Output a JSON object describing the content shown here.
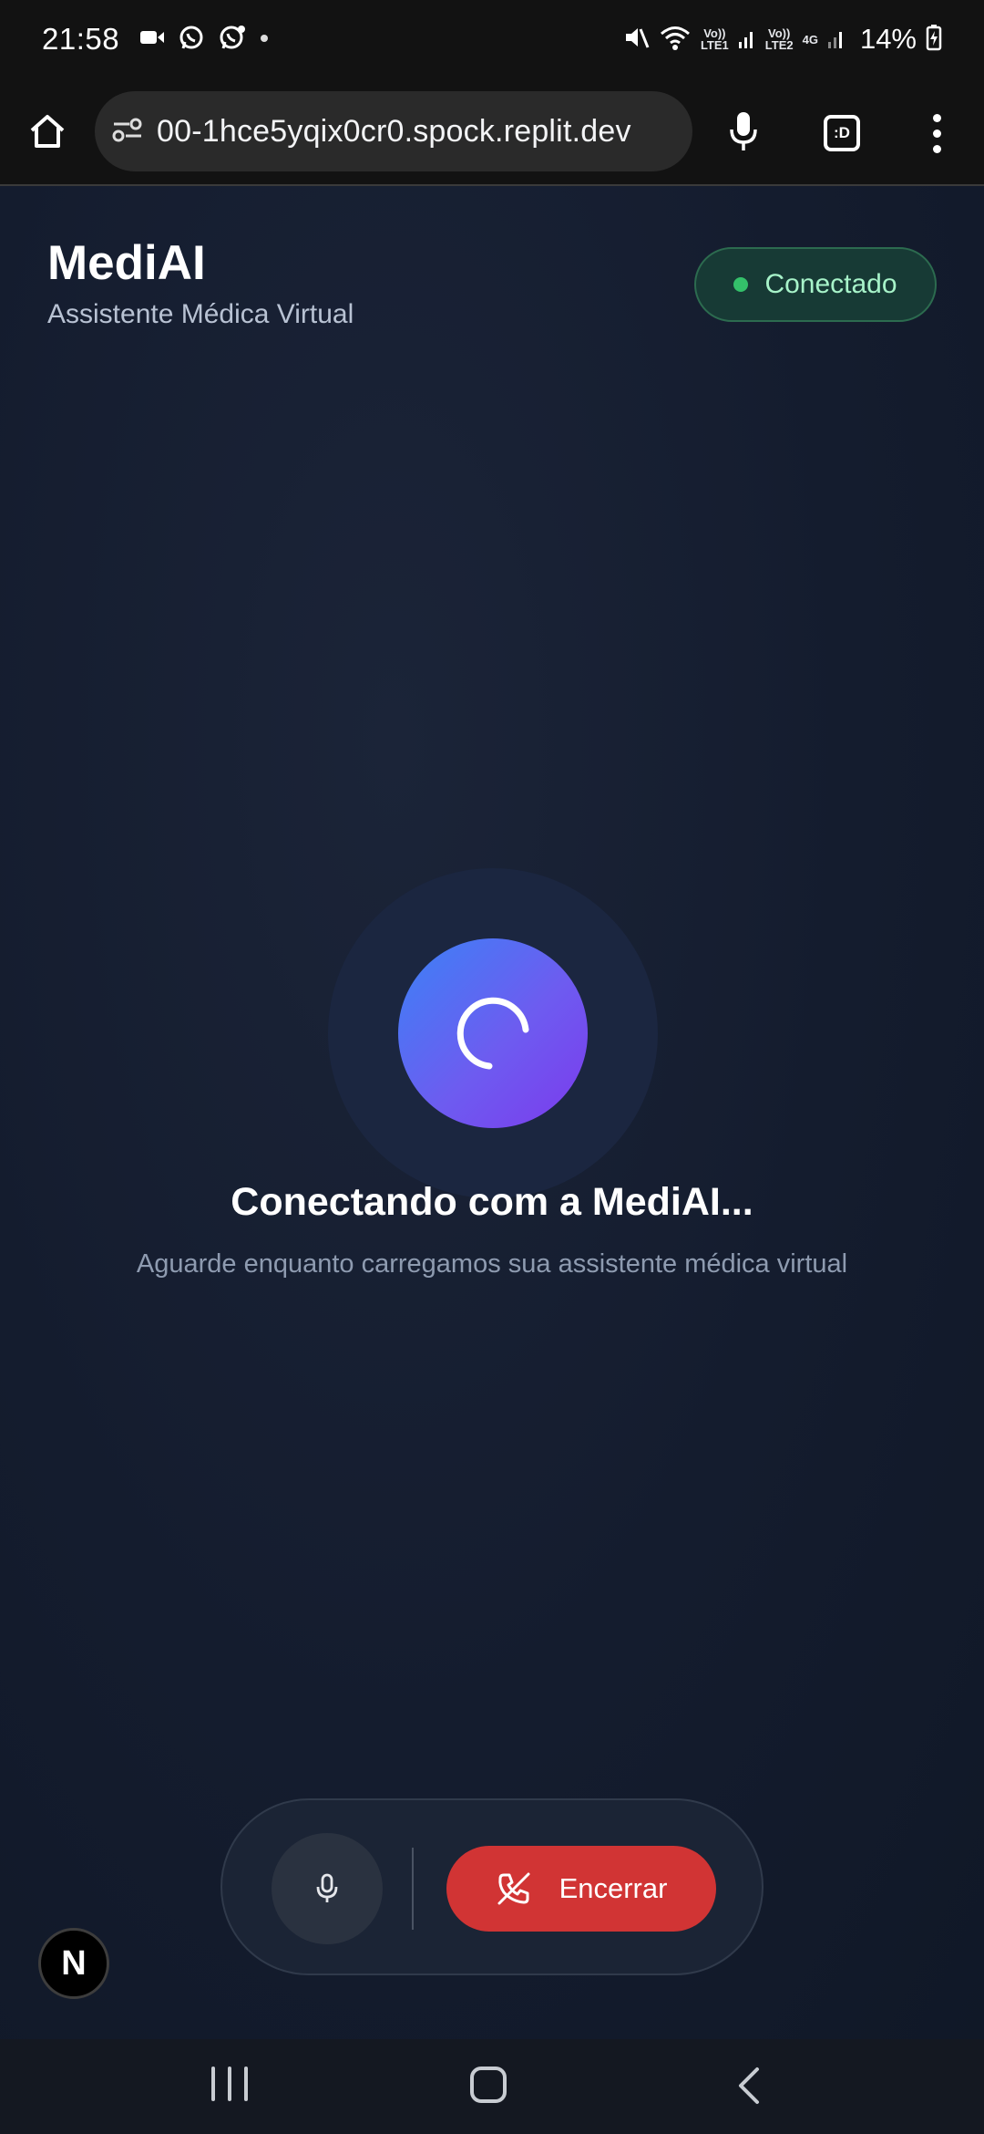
{
  "status_bar": {
    "time": "21:58",
    "battery": "14%",
    "sim1_label": "Vo))\nLTE1",
    "sim2_label": "Vo))\nLTE2",
    "network": "4G"
  },
  "browser": {
    "url": "00-1hce5yqix0cr0.spock.replit.dev",
    "tabs_label": ":D"
  },
  "app": {
    "title": "MediAI",
    "subtitle": "Assistente Médica Virtual",
    "status": "Conectado"
  },
  "loading": {
    "title": "Conectando com a MediAI...",
    "subtitle": "Aguarde enquanto carregamos sua assistente médica virtual"
  },
  "controls": {
    "end_label": "Encerrar"
  },
  "badge": {
    "letter": "N"
  },
  "colors": {
    "accent_green": "#34c06a",
    "end_red": "#d13434",
    "gradient_start": "#3b82f6",
    "gradient_end": "#7c3aed"
  }
}
